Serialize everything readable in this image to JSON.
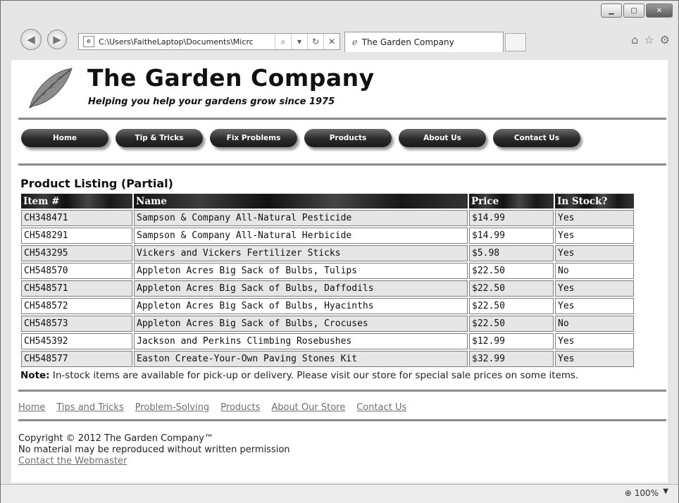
{
  "browser": {
    "address": "C:\\Users\\FaitheLaptop\\Documents\\Micrc",
    "search_icon": "magnifier-icon",
    "tab_title": "The Garden Company",
    "zoom": "100%"
  },
  "site": {
    "title": "The Garden Company",
    "tagline": "Helping you help your gardens grow since 1975"
  },
  "nav": [
    "Home",
    "Tip & Tricks",
    "Fix Problems",
    "Products",
    "About Us",
    "Contact Us"
  ],
  "listing": {
    "title": "Product Listing (Partial)",
    "columns": [
      "Item #",
      "Name",
      "Price",
      "In Stock?"
    ],
    "rows": [
      [
        "CH348471",
        "Sampson & Company All-Natural Pesticide",
        "$14.99",
        "Yes"
      ],
      [
        "CH548291",
        "Sampson & Company All-Natural Herbicide",
        "$14.99",
        "Yes"
      ],
      [
        "CH543295",
        "Vickers and Vickers Fertilizer Sticks",
        "$5.98",
        "Yes"
      ],
      [
        "CH548570",
        "Appleton Acres Big Sack of Bulbs, Tulips",
        "$22.50",
        "No"
      ],
      [
        "CH548571",
        "Appleton Acres Big Sack of Bulbs, Daffodils",
        "$22.50",
        "Yes"
      ],
      [
        "CH548572",
        "Appleton Acres Big Sack of Bulbs, Hyacinths",
        "$22.50",
        "Yes"
      ],
      [
        "CH548573",
        "Appleton Acres Big Sack of Bulbs, Crocuses",
        "$22.50",
        "No"
      ],
      [
        "CH545392",
        "Jackson and Perkins Climbing Rosebushes",
        "$12.99",
        "Yes"
      ],
      [
        "CH548577",
        "Easton Create-Your-Own Paving Stones Kit",
        "$32.99",
        "Yes"
      ]
    ],
    "note_label": "Note:",
    "note_text": " In-stock items are available for pick-up or delivery. Please visit our store for special sale prices on some items."
  },
  "footer": {
    "links": [
      "Home",
      "Tips and Tricks",
      "Problem-Solving",
      "Products",
      "About Our Store",
      "Contact Us"
    ],
    "copyright": "Copyright © 2012 The Garden Company™",
    "permission": "No material may be reproduced without written permission",
    "webmaster": "Contact the Webmaster"
  }
}
